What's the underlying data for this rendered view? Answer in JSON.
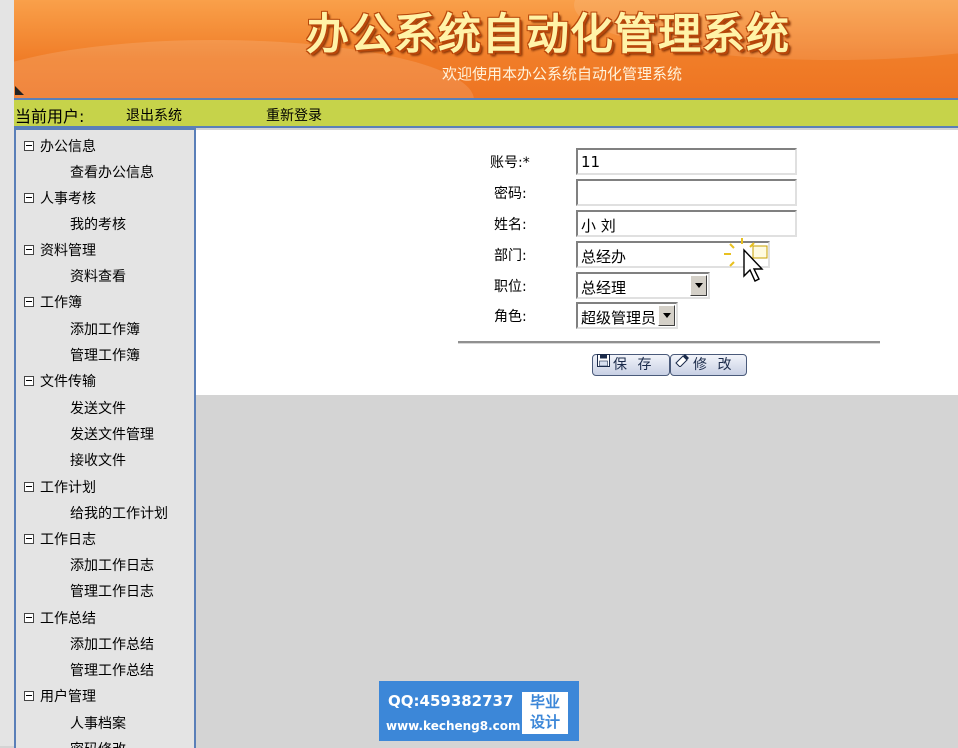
{
  "header": {
    "title": "办公系统自动化管理系统",
    "subtitle": "欢迎使用本办公系统自动化管理系统"
  },
  "userbar": {
    "current_user": "当前用户:",
    "logout": "退出系统",
    "relogin": "重新登录"
  },
  "sidebar": {
    "groups": [
      {
        "label": "办公信息",
        "items": [
          "查看办公信息"
        ]
      },
      {
        "label": "人事考核",
        "items": [
          "我的考核"
        ]
      },
      {
        "label": "资料管理",
        "items": [
          "资料查看"
        ]
      },
      {
        "label": "工作簿",
        "items": [
          "添加工作簿",
          "管理工作簿"
        ]
      },
      {
        "label": "文件传输",
        "items": [
          "发送文件",
          "发送文件管理",
          "接收文件"
        ]
      },
      {
        "label": "工作计划",
        "items": [
          "给我的工作计划"
        ]
      },
      {
        "label": "工作日志",
        "items": [
          "添加工作日志",
          "管理工作日志"
        ]
      },
      {
        "label": "工作总结",
        "items": [
          "添加工作总结",
          "管理工作总结"
        ]
      },
      {
        "label": "用户管理",
        "items": [
          "人事档案",
          "密码修改"
        ]
      }
    ]
  },
  "form": {
    "account": {
      "label": "账号:*",
      "value": "11"
    },
    "password": {
      "label": "密码:",
      "value": ""
    },
    "name": {
      "label": "姓名:",
      "value": "小 刘"
    },
    "department": {
      "label": "部门:",
      "value": "总经办"
    },
    "position": {
      "label": "职位:",
      "value": "总经理"
    },
    "role": {
      "label": "角色:",
      "value": "超级管理员"
    },
    "save_label": "保 存",
    "edit_label": "修 改"
  },
  "watermark": {
    "qq": "QQ:459382737",
    "url": "www.kecheng8.com",
    "badge_line1": "毕业",
    "badge_line2": "设计"
  },
  "colors": {
    "banner": "#f07d28",
    "userbar": "#c6d34a",
    "border_blue": "#5a7fb8",
    "watermark_blue": "#3c87d8"
  }
}
